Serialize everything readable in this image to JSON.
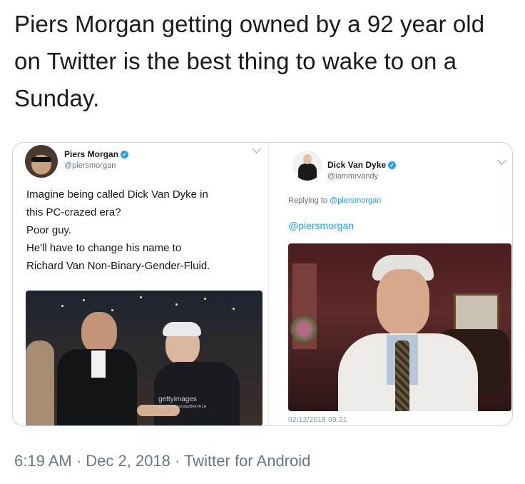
{
  "headline": "Piers Morgan getting owned by a 92 year old on Twitter is the best thing to wake to on a Sunday.",
  "left_tweet": {
    "display_name": "Piers Morgan",
    "handle": "@piersmorgan",
    "text_lines": [
      "Imagine being called Dick Van Dyke in",
      "this PC-crazed era?",
      "Poor guy.",
      "He'll have to change his name to",
      "Richard Van Non-Binary-Gender-Fluid."
    ],
    "image_watermark": "getty",
    "image_watermark_suffix": "images",
    "image_credit": "Kevork Djansezian/BAFTA LA"
  },
  "right_tweet": {
    "display_name": "Dick Van Dyke",
    "handle": "@iammrvandy",
    "replying_prefix": "Replying to ",
    "replying_handle": "@piersmorgan",
    "reply_text": "@piersmorgan",
    "image_timestamp": "02/12/2018  09:21"
  },
  "icons": {
    "verified": "verified-badge-icon",
    "chevron": "chevron-down-icon"
  },
  "colors": {
    "twitter_blue": "#1da1f2",
    "meta_gray": "#657786"
  },
  "footer": {
    "meta": "6:19 AM · Dec 2, 2018 · Twitter for Android"
  }
}
